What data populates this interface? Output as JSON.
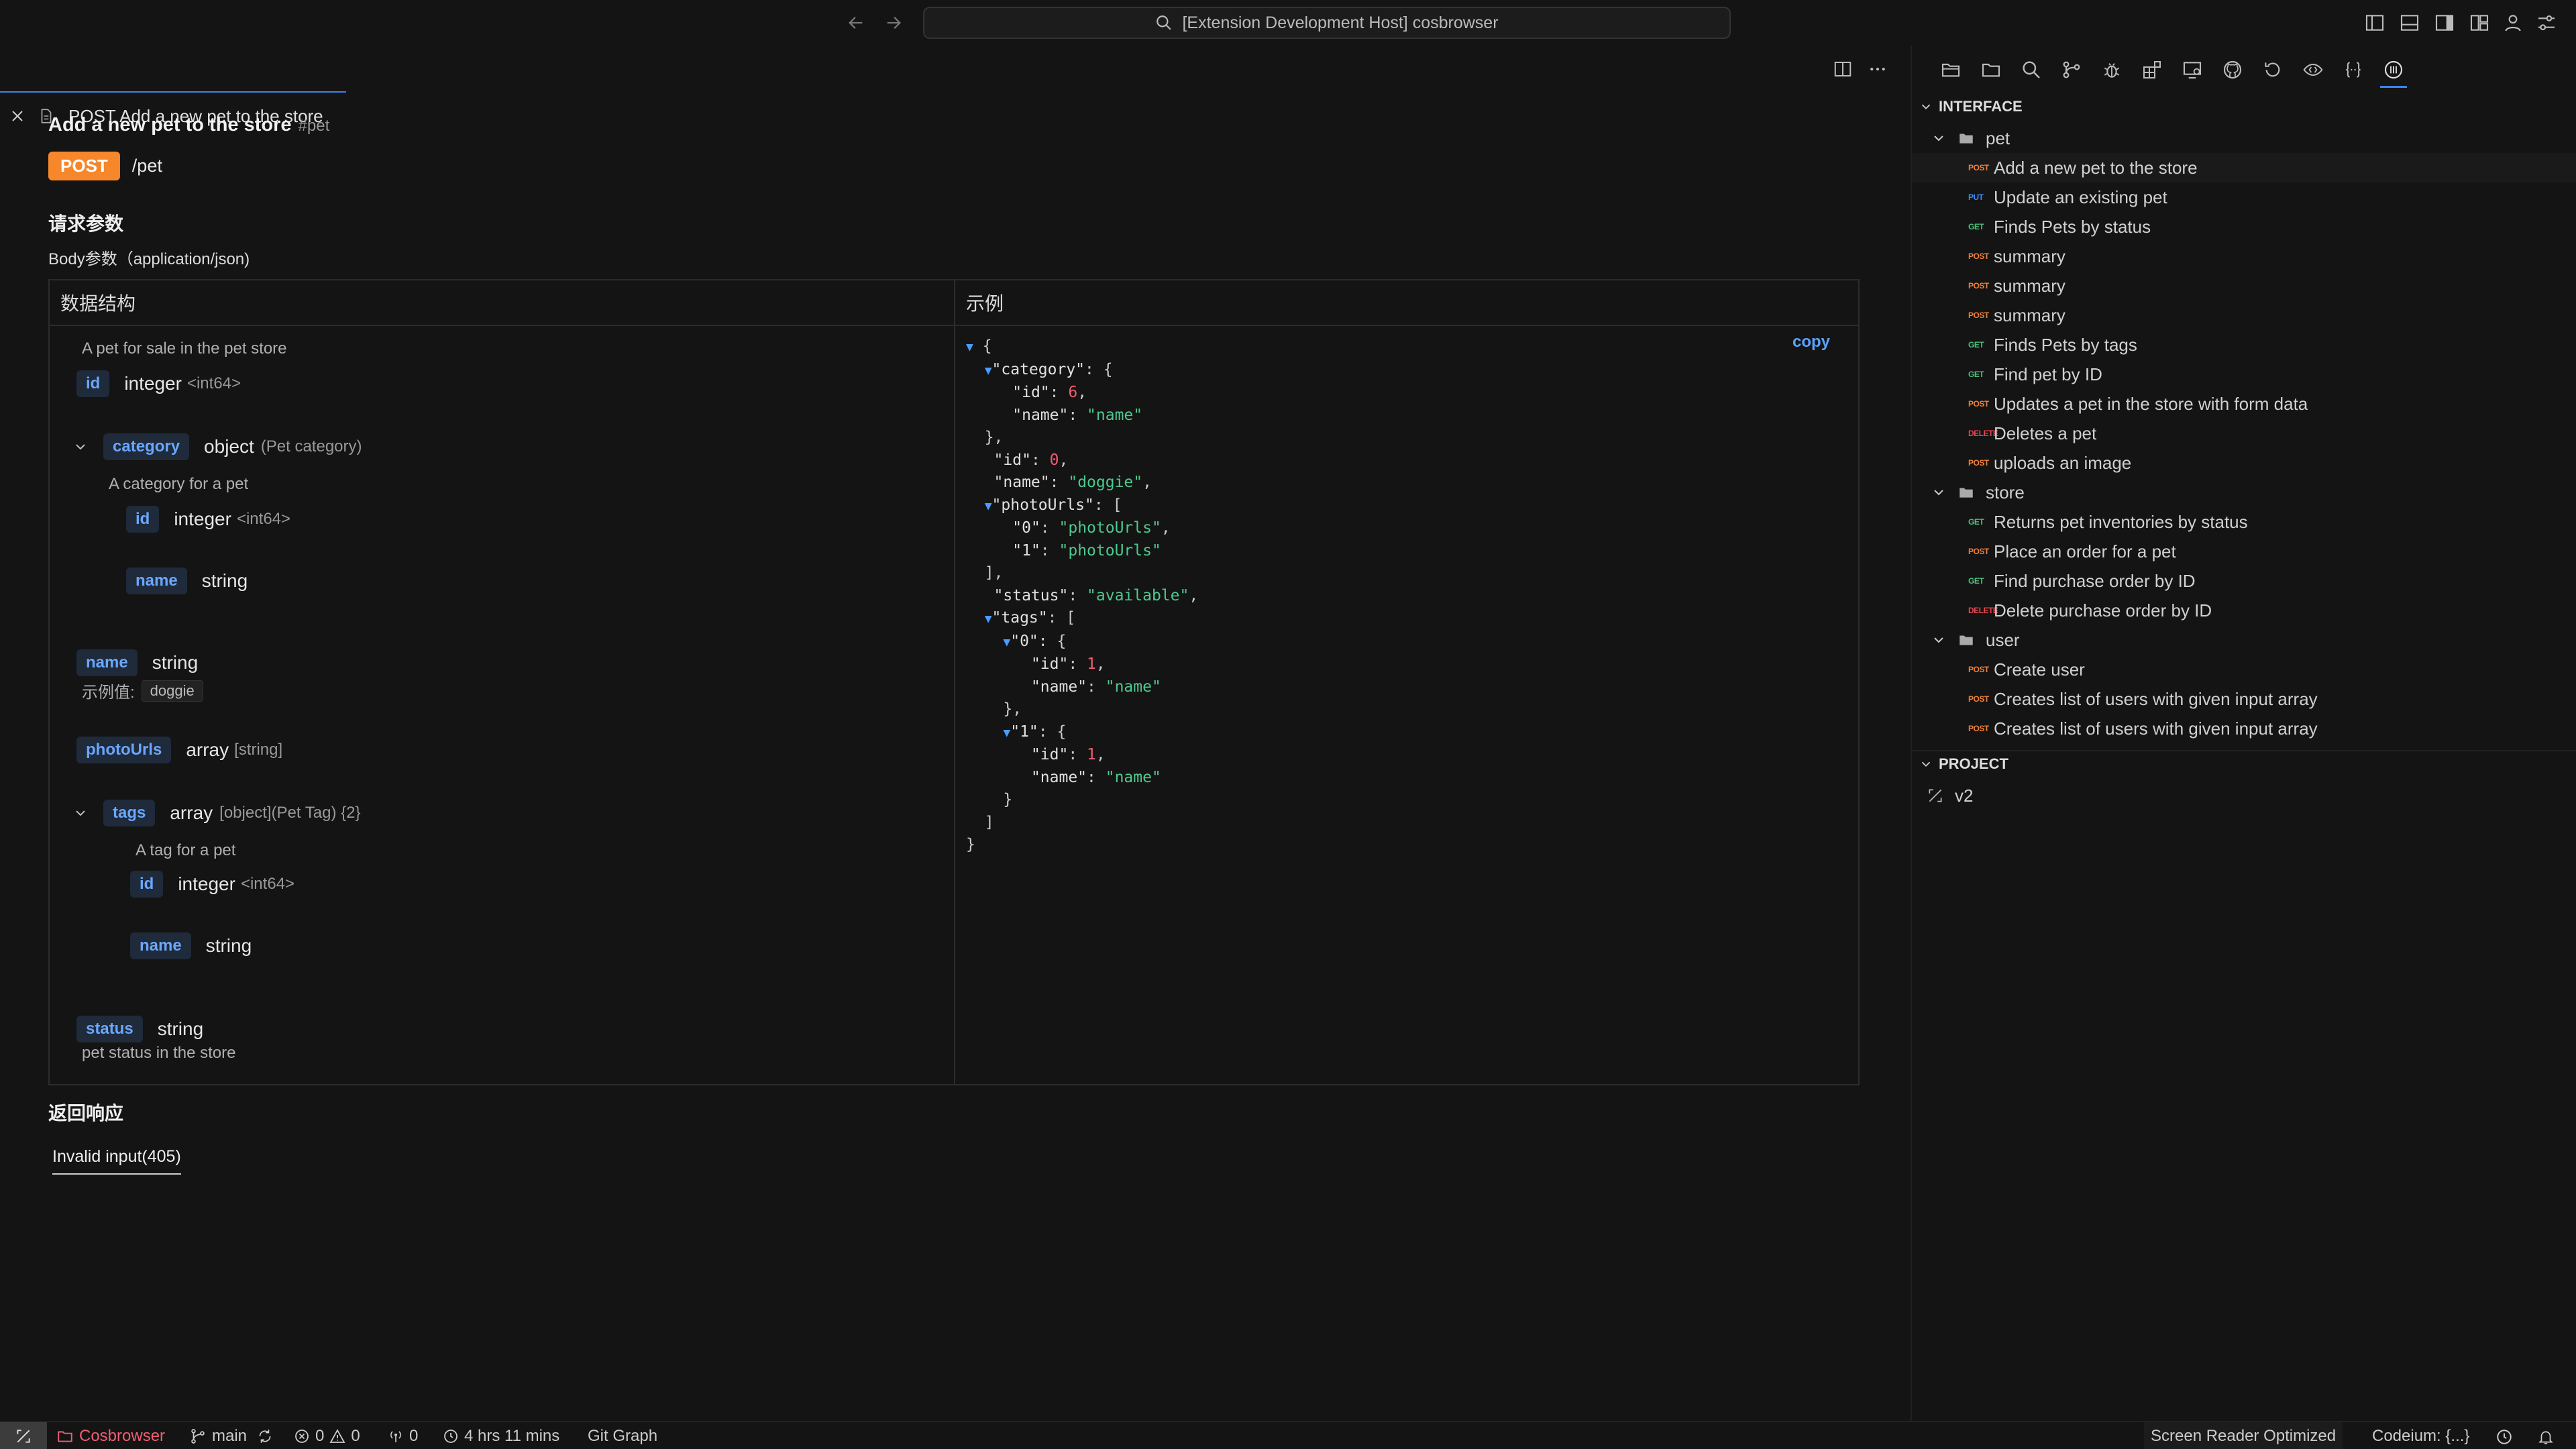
{
  "titlebar": {
    "search_text": "[Extension Development Host] cosbrowser"
  },
  "tab": {
    "title": "POST Add a new pet to the store"
  },
  "main": {
    "title": "Add a new pet to the store",
    "tag": "#pet",
    "method": "POST",
    "path": "/pet",
    "request_params_heading": "请求参数",
    "body_params_label": "Body参数（application/json)",
    "schema_header": "数据结构",
    "example_header": "示例",
    "copy_label": "copy",
    "schema_desc": "A pet for sale in the pet store",
    "fields": {
      "id": {
        "name": "id",
        "type": "integer",
        "format": "<int64>"
      },
      "category": {
        "name": "category",
        "type": "object",
        "meta": "(Pet category)",
        "desc": "A category for a pet",
        "id_name": "id",
        "id_type": "integer",
        "id_format": "<int64>",
        "name_name": "name",
        "name_type": "string"
      },
      "name": {
        "name": "name",
        "type": "string",
        "example_label": "示例值:",
        "example_value": "doggie"
      },
      "photoUrls": {
        "name": "photoUrls",
        "type": "array",
        "meta": "[string]"
      },
      "tags": {
        "name": "tags",
        "type": "array",
        "meta": "[object](Pet Tag) {2}",
        "desc": "A tag for a pet",
        "id_name": "id",
        "id_type": "integer",
        "id_format": "<int64>",
        "name_name": "name",
        "name_type": "string"
      },
      "status": {
        "name": "status",
        "type": "string",
        "desc": "pet status in the store"
      }
    },
    "response_heading": "返回响应",
    "response_tab": "Invalid input(405)"
  },
  "example_json": {
    "category_id": "6",
    "category_name": "\"name\"",
    "id": "0",
    "name": "\"doggie\"",
    "photo0": "\"photoUrls\"",
    "photo1": "\"photoUrls\"",
    "status": "\"available\"",
    "tag0_id": "1",
    "tag0_name": "\"name\"",
    "tag1_id": "1",
    "tag1_name": "\"name\""
  },
  "sidebar": {
    "interface_heading": "INTERFACE",
    "project_heading": "PROJECT",
    "project_item": "v2",
    "groups": [
      {
        "name": "pet",
        "items": [
          {
            "method": "POST",
            "label": "Add a new pet to the store"
          },
          {
            "method": "PUT",
            "label": "Update an existing pet"
          },
          {
            "method": "GET",
            "label": "Finds Pets by status"
          },
          {
            "method": "POST",
            "label": "summary"
          },
          {
            "method": "POST",
            "label": "summary"
          },
          {
            "method": "POST",
            "label": "summary"
          },
          {
            "method": "GET",
            "label": "Finds Pets by tags"
          },
          {
            "method": "GET",
            "label": "Find pet by ID"
          },
          {
            "method": "POST",
            "label": "Updates a pet in the store with form data"
          },
          {
            "method": "DELETE",
            "label": "Deletes a pet"
          },
          {
            "method": "POST",
            "label": "uploads an image"
          }
        ]
      },
      {
        "name": "store",
        "items": [
          {
            "method": "GET",
            "label": "Returns pet inventories by status"
          },
          {
            "method": "POST",
            "label": "Place an order for a pet"
          },
          {
            "method": "GET",
            "label": "Find purchase order by ID"
          },
          {
            "method": "DELETE",
            "label": "Delete purchase order by ID"
          }
        ]
      },
      {
        "name": "user",
        "items": [
          {
            "method": "POST",
            "label": "Create user"
          },
          {
            "method": "POST",
            "label": "Creates list of users with given input array"
          },
          {
            "method": "POST",
            "label": "Creates list of users with given input array"
          }
        ]
      }
    ]
  },
  "statusbar": {
    "remote": "Cosbrowser",
    "branch": "main",
    "errors": "0",
    "warnings": "0",
    "ports": "0",
    "time": "4 hrs 11 mins",
    "git_graph": "Git Graph",
    "screen_reader": "Screen Reader Optimized",
    "codeium": "Codeium: {...}"
  },
  "colors": {
    "post": "#f6872b",
    "accent": "#3b82f6",
    "field_name": "#6aa7ff",
    "json_string": "#4ec98f",
    "json_number": "#f05d73"
  }
}
